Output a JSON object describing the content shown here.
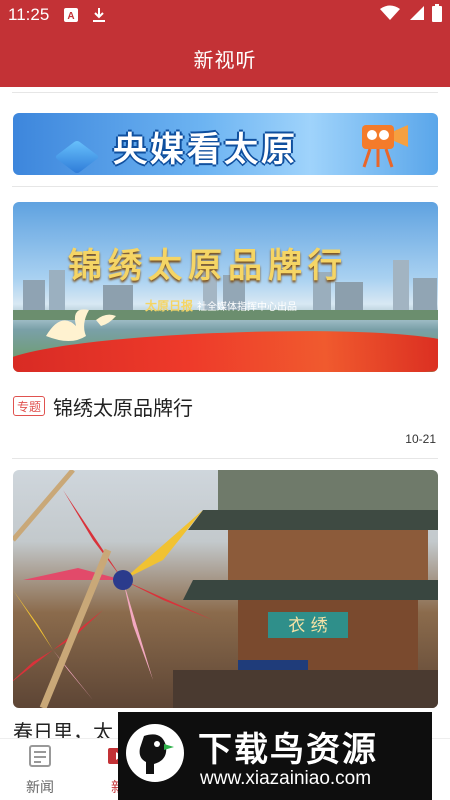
{
  "status_bar": {
    "time": "11:25",
    "icons": [
      "font-icon",
      "download-icon",
      "wifi-icon",
      "signal-icon",
      "battery-icon"
    ]
  },
  "header": {
    "title": "新视听"
  },
  "banner": {
    "text": "央媒看太原",
    "icons": [
      "cube-icon",
      "camera-icon"
    ]
  },
  "feed": [
    {
      "image_title": "锦绣太原品牌行",
      "image_brand": "太原日报",
      "image_subtitle": "社全媒体指挥中心出品",
      "tag": "专题",
      "title": "锦绣太原品牌行",
      "date": "10-21"
    },
    {
      "image_sign": "衣 绣",
      "title": "春日里，太"
    }
  ],
  "bottom_nav": {
    "items": [
      {
        "label": "新闻",
        "icon": "news-icon",
        "active": false
      },
      {
        "label": "新",
        "icon": "video-icon",
        "active": true
      }
    ]
  },
  "watermark": {
    "text_cn": "下载鸟资源",
    "url": "www.xiazainiao.com"
  },
  "colors": {
    "brand_red": "#c33236",
    "tag_red": "#e0524f"
  }
}
